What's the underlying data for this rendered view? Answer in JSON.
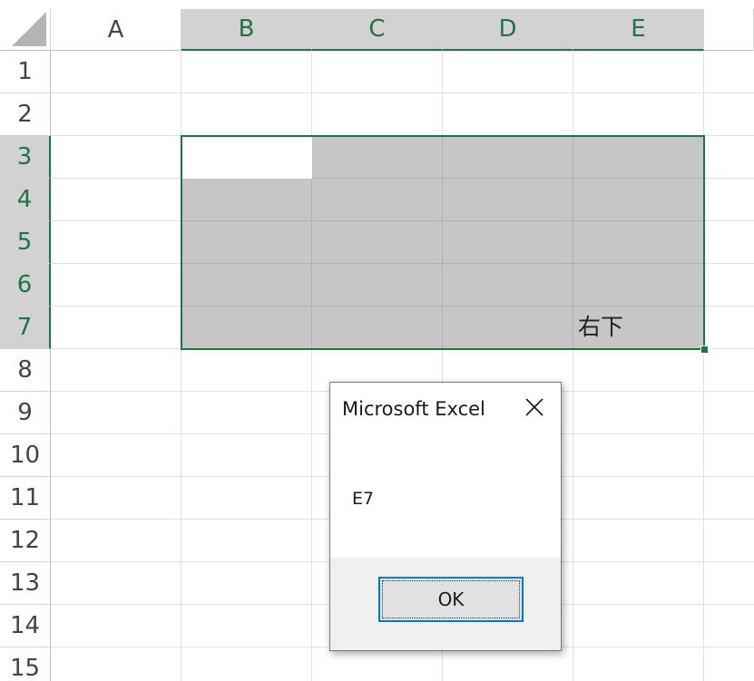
{
  "sheet": {
    "columns": [
      {
        "label": "A",
        "selected": false
      },
      {
        "label": "B",
        "selected": true
      },
      {
        "label": "C",
        "selected": true
      },
      {
        "label": "D",
        "selected": true
      },
      {
        "label": "E",
        "selected": true
      }
    ],
    "rows": [
      {
        "label": "1",
        "selected": false
      },
      {
        "label": "2",
        "selected": false
      },
      {
        "label": "3",
        "selected": true
      },
      {
        "label": "4",
        "selected": true
      },
      {
        "label": "5",
        "selected": true
      },
      {
        "label": "6",
        "selected": true
      },
      {
        "label": "7",
        "selected": true
      },
      {
        "label": "8",
        "selected": false
      },
      {
        "label": "9",
        "selected": false
      },
      {
        "label": "10",
        "selected": false
      },
      {
        "label": "11",
        "selected": false
      },
      {
        "label": "12",
        "selected": false
      },
      {
        "label": "13",
        "selected": false
      },
      {
        "label": "14",
        "selected": false
      },
      {
        "label": "15",
        "selected": false
      }
    ],
    "selection_range": "B3:E7",
    "active_cell": "B3",
    "cells": {
      "E7": "右下"
    }
  },
  "dialog": {
    "title": "Microsoft Excel",
    "message": "E7",
    "ok_label": "OK"
  },
  "colors": {
    "accent": "#217346",
    "selection_fill": "#c6c6c6",
    "header_selected": "#d2d2d2",
    "button_focus": "#0078d7"
  },
  "icons": {
    "close": "close-icon",
    "corner": "select-all-triangle-icon"
  }
}
